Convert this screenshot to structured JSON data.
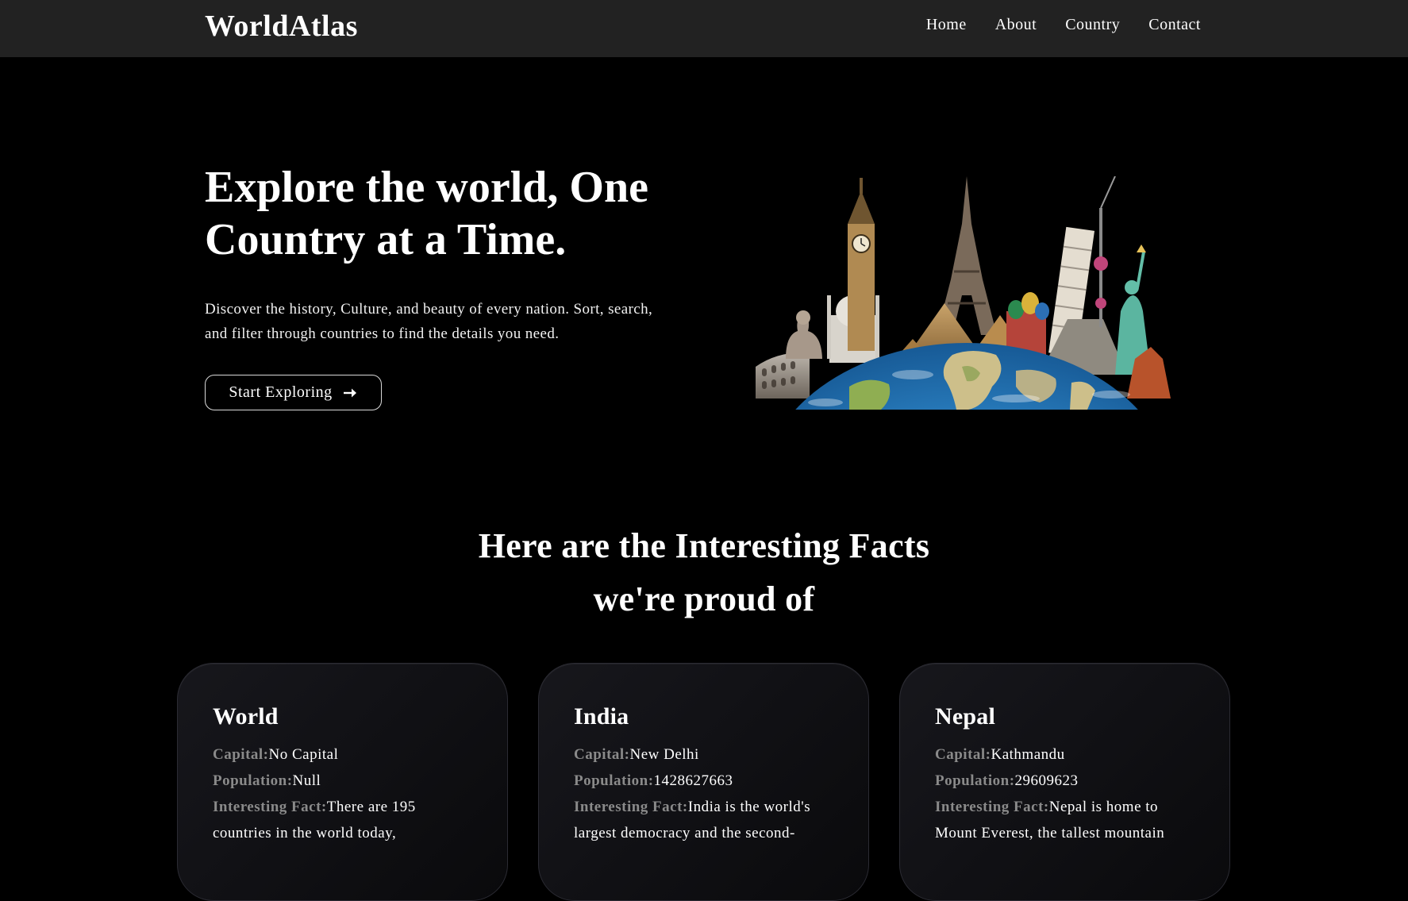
{
  "header": {
    "logo": "WorldAtlas",
    "nav": [
      "Home",
      "About",
      "Country",
      "Contact"
    ]
  },
  "hero": {
    "title": "Explore the world, One Country at a Time.",
    "description": "Discover the history, Culture, and beauty of every nation. Sort, search, and filter through countries to find the details you need.",
    "button_label": "Start Exploring",
    "button_icon": "arrow-right-icon",
    "illustration": "world-landmarks-globe-illustration"
  },
  "facts": {
    "title_line1": "Here are the Interesting Facts",
    "title_line2": "we're proud of",
    "labels": {
      "capital": "Capital:",
      "population": "Population:",
      "fact": "Interesting Fact:"
    },
    "cards": [
      {
        "name": "World",
        "capital": "No Capital",
        "population": "Null",
        "fact": "There are 195 countries in the world today,"
      },
      {
        "name": "India",
        "capital": "New Delhi",
        "population": "1428627663",
        "fact": "India is the world's largest democracy and the second-"
      },
      {
        "name": "Nepal",
        "capital": "Kathmandu",
        "population": "29609623",
        "fact": "Nepal is home to Mount Everest, the tallest mountain"
      }
    ]
  },
  "colors": {
    "background": "#000000",
    "header": "#222222",
    "label_gray": "#8a8a8a",
    "ocean_blue": "#2f86c9"
  }
}
